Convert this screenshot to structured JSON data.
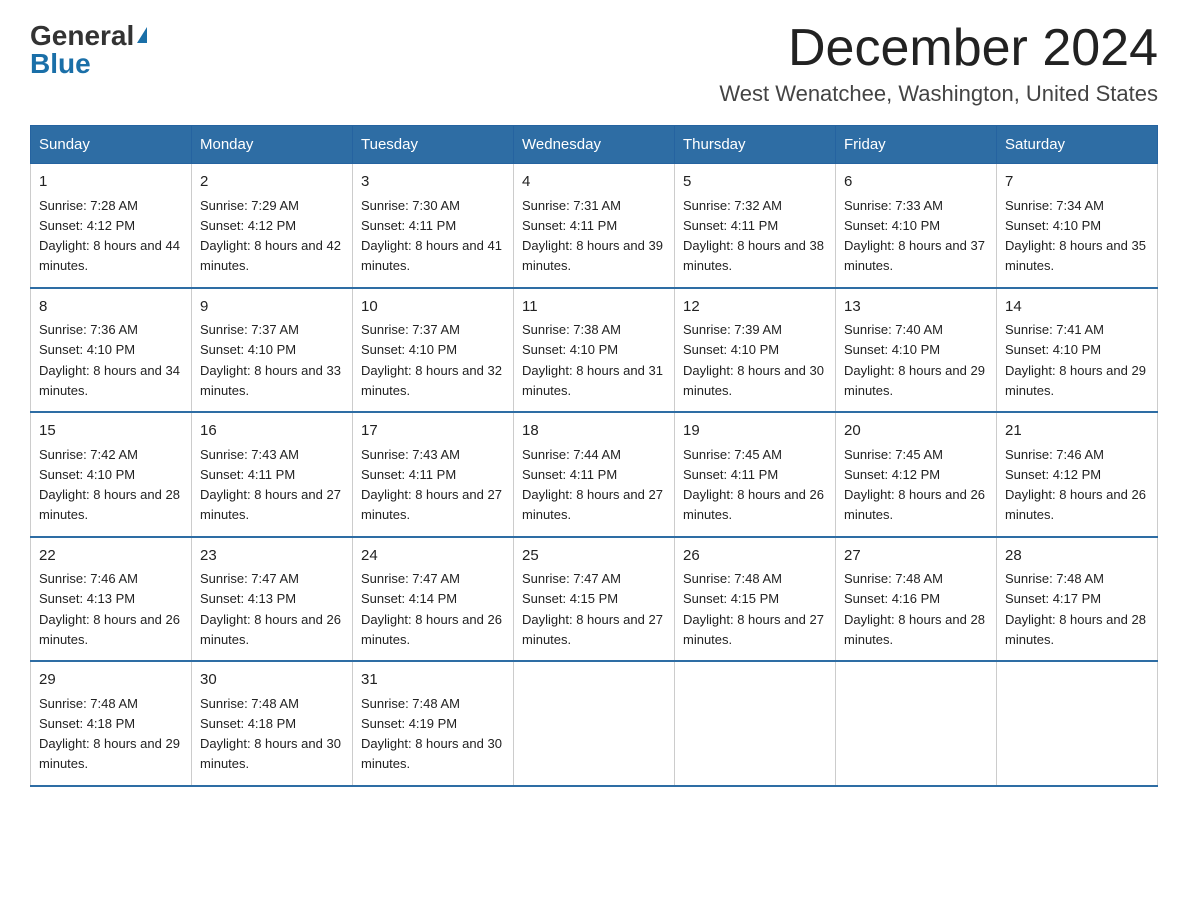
{
  "header": {
    "logo_general": "General",
    "logo_blue": "Blue",
    "month_title": "December 2024",
    "location": "West Wenatchee, Washington, United States"
  },
  "days_of_week": [
    "Sunday",
    "Monday",
    "Tuesday",
    "Wednesday",
    "Thursday",
    "Friday",
    "Saturday"
  ],
  "weeks": [
    [
      {
        "day": "1",
        "sunrise": "7:28 AM",
        "sunset": "4:12 PM",
        "daylight": "8 hours and 44 minutes."
      },
      {
        "day": "2",
        "sunrise": "7:29 AM",
        "sunset": "4:12 PM",
        "daylight": "8 hours and 42 minutes."
      },
      {
        "day": "3",
        "sunrise": "7:30 AM",
        "sunset": "4:11 PM",
        "daylight": "8 hours and 41 minutes."
      },
      {
        "day": "4",
        "sunrise": "7:31 AM",
        "sunset": "4:11 PM",
        "daylight": "8 hours and 39 minutes."
      },
      {
        "day": "5",
        "sunrise": "7:32 AM",
        "sunset": "4:11 PM",
        "daylight": "8 hours and 38 minutes."
      },
      {
        "day": "6",
        "sunrise": "7:33 AM",
        "sunset": "4:10 PM",
        "daylight": "8 hours and 37 minutes."
      },
      {
        "day": "7",
        "sunrise": "7:34 AM",
        "sunset": "4:10 PM",
        "daylight": "8 hours and 35 minutes."
      }
    ],
    [
      {
        "day": "8",
        "sunrise": "7:36 AM",
        "sunset": "4:10 PM",
        "daylight": "8 hours and 34 minutes."
      },
      {
        "day": "9",
        "sunrise": "7:37 AM",
        "sunset": "4:10 PM",
        "daylight": "8 hours and 33 minutes."
      },
      {
        "day": "10",
        "sunrise": "7:37 AM",
        "sunset": "4:10 PM",
        "daylight": "8 hours and 32 minutes."
      },
      {
        "day": "11",
        "sunrise": "7:38 AM",
        "sunset": "4:10 PM",
        "daylight": "8 hours and 31 minutes."
      },
      {
        "day": "12",
        "sunrise": "7:39 AM",
        "sunset": "4:10 PM",
        "daylight": "8 hours and 30 minutes."
      },
      {
        "day": "13",
        "sunrise": "7:40 AM",
        "sunset": "4:10 PM",
        "daylight": "8 hours and 29 minutes."
      },
      {
        "day": "14",
        "sunrise": "7:41 AM",
        "sunset": "4:10 PM",
        "daylight": "8 hours and 29 minutes."
      }
    ],
    [
      {
        "day": "15",
        "sunrise": "7:42 AM",
        "sunset": "4:10 PM",
        "daylight": "8 hours and 28 minutes."
      },
      {
        "day": "16",
        "sunrise": "7:43 AM",
        "sunset": "4:11 PM",
        "daylight": "8 hours and 27 minutes."
      },
      {
        "day": "17",
        "sunrise": "7:43 AM",
        "sunset": "4:11 PM",
        "daylight": "8 hours and 27 minutes."
      },
      {
        "day": "18",
        "sunrise": "7:44 AM",
        "sunset": "4:11 PM",
        "daylight": "8 hours and 27 minutes."
      },
      {
        "day": "19",
        "sunrise": "7:45 AM",
        "sunset": "4:11 PM",
        "daylight": "8 hours and 26 minutes."
      },
      {
        "day": "20",
        "sunrise": "7:45 AM",
        "sunset": "4:12 PM",
        "daylight": "8 hours and 26 minutes."
      },
      {
        "day": "21",
        "sunrise": "7:46 AM",
        "sunset": "4:12 PM",
        "daylight": "8 hours and 26 minutes."
      }
    ],
    [
      {
        "day": "22",
        "sunrise": "7:46 AM",
        "sunset": "4:13 PM",
        "daylight": "8 hours and 26 minutes."
      },
      {
        "day": "23",
        "sunrise": "7:47 AM",
        "sunset": "4:13 PM",
        "daylight": "8 hours and 26 minutes."
      },
      {
        "day": "24",
        "sunrise": "7:47 AM",
        "sunset": "4:14 PM",
        "daylight": "8 hours and 26 minutes."
      },
      {
        "day": "25",
        "sunrise": "7:47 AM",
        "sunset": "4:15 PM",
        "daylight": "8 hours and 27 minutes."
      },
      {
        "day": "26",
        "sunrise": "7:48 AM",
        "sunset": "4:15 PM",
        "daylight": "8 hours and 27 minutes."
      },
      {
        "day": "27",
        "sunrise": "7:48 AM",
        "sunset": "4:16 PM",
        "daylight": "8 hours and 28 minutes."
      },
      {
        "day": "28",
        "sunrise": "7:48 AM",
        "sunset": "4:17 PM",
        "daylight": "8 hours and 28 minutes."
      }
    ],
    [
      {
        "day": "29",
        "sunrise": "7:48 AM",
        "sunset": "4:18 PM",
        "daylight": "8 hours and 29 minutes."
      },
      {
        "day": "30",
        "sunrise": "7:48 AM",
        "sunset": "4:18 PM",
        "daylight": "8 hours and 30 minutes."
      },
      {
        "day": "31",
        "sunrise": "7:48 AM",
        "sunset": "4:19 PM",
        "daylight": "8 hours and 30 minutes."
      },
      null,
      null,
      null,
      null
    ]
  ]
}
